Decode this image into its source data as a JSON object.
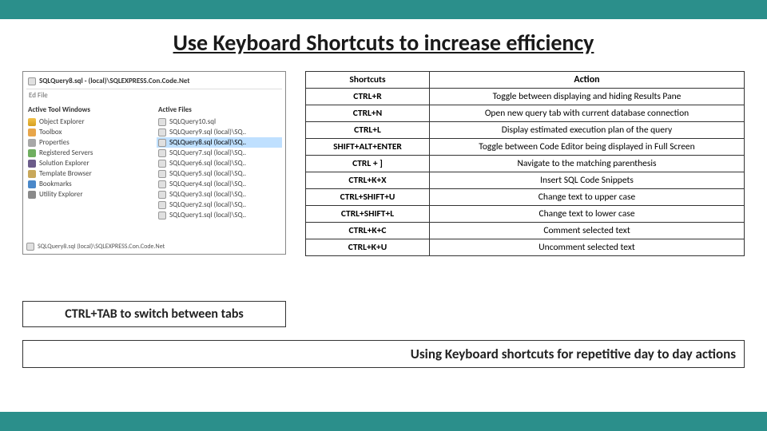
{
  "title": "Use Keyboard Shortcuts to increase efficiency",
  "screenshot": {
    "tab_title": "SQLQuery8.sql - (local)\\SQLEXPRESS.Con.Code.Net",
    "menu": "Ed File",
    "left_header": "Active Tool Windows",
    "right_header": "Active Files",
    "tool_windows": [
      "Object Explorer",
      "Toolbox",
      "Properties",
      "Registered Servers",
      "Solution Explorer",
      "Template Browser",
      "Bookmarks",
      "Utility Explorer"
    ],
    "active_files": [
      "SQLQuery10.sql",
      "SQLQuery9.sql   (local)\\SQ..",
      "SQLQuery8.sql   (local)\\SQ..",
      "SQLQuery7.sql   (local)\\SQ..",
      "SQLQuery6.sql   (local)\\SQ..",
      "SQLQuery5.sql   (local)\\SQ..",
      "SQLQuery4.sql   (local)\\SQ..",
      "SQLQuery3.sql   (local)\\SQ..",
      "SQLQuery2.sql   (local)\\SQ..",
      "SQLQuery1.sql   (local)\\SQ.."
    ],
    "selected_index": 2,
    "status": "SQLQuery8.sql   (local)\\SQLEXPRESS.Con.Code.Net"
  },
  "caption": "CTRL+TAB to switch between tabs",
  "table": {
    "headers": [
      "Shortcuts",
      "Action"
    ],
    "rows": [
      {
        "shortcut": "CTRL+R",
        "action": "Toggle between displaying and hiding Results Pane"
      },
      {
        "shortcut": "CTRL+N",
        "action": "Open new query tab with current database connection"
      },
      {
        "shortcut": "CTRL+L",
        "action": "Display estimated execution plan of the query"
      },
      {
        "shortcut": "SHIFT+ALT+ENTER",
        "action": "Toggle between Code Editor being displayed in Full Screen"
      },
      {
        "shortcut": "CTRL + ]",
        "action": "Navigate to the matching parenthesis"
      },
      {
        "shortcut": "CTRL+K+X",
        "action": "Insert SQL Code Snippets"
      },
      {
        "shortcut": "CTRL+SHIFT+U",
        "action": "Change text to upper case"
      },
      {
        "shortcut": "CTRL+SHIFT+L",
        "action": "Change text to lower case"
      },
      {
        "shortcut": "CTRL+K+C",
        "action": "Comment selected text"
      },
      {
        "shortcut": "CTRL+K+U",
        "action": "Uncomment selected text"
      }
    ]
  },
  "footnote": "Using Keyboard shortcuts for repetitive day to day actions"
}
